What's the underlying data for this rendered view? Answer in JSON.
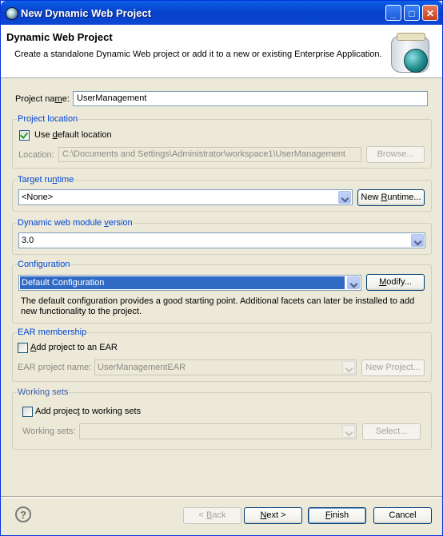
{
  "window": {
    "title": "New Dynamic Web Project",
    "minimize": "_",
    "maximize": "□",
    "close": "✕"
  },
  "header": {
    "title": "Dynamic Web Project",
    "description": "Create a standalone Dynamic Web project or add it to a new or existing Enterprise Application."
  },
  "project_name": {
    "label_pre": "Project na",
    "label_u": "m",
    "label_post": "e:",
    "value": "UserManagement"
  },
  "project_location": {
    "title": "Project location",
    "use_default": {
      "pre": "Use ",
      "u": "d",
      "post": "efault location",
      "checked": true
    },
    "location_label": "Location:",
    "location_value": "C:\\Documents and Settings\\Administrator\\workspace1\\UserManagement",
    "browse_label": "Browse..."
  },
  "target_runtime": {
    "title_pre": "Target ru",
    "title_u": "n",
    "title_post": "time",
    "value": "<None>",
    "new_runtime_pre": "New ",
    "new_runtime_u": "R",
    "new_runtime_post": "untime..."
  },
  "module_version": {
    "title_pre": "Dynamic web module ",
    "title_u": "v",
    "title_post": "ersion",
    "value": "3.0"
  },
  "configuration": {
    "title": "Configuration",
    "value": "Default Configuration",
    "modify_pre": "",
    "modify_u": "M",
    "modify_post": "odify...",
    "description_line1": "The default configuration provides a good starting point. Additional facets can later be installed to add",
    "description_line2": "new functionality to the project."
  },
  "ear": {
    "title": "EAR membership",
    "add_pre": "",
    "add_u": "A",
    "add_post": "dd project to an EAR",
    "checked": false,
    "name_label": "EAR project name:",
    "name_value": "UserManagementEAR",
    "new_project_label": "New Project..."
  },
  "working_sets": {
    "title": "Working sets",
    "add_pre": "Add projec",
    "add_u": "t",
    "add_post": " to working sets",
    "checked": false,
    "label": "Working sets:",
    "value": "",
    "select_label": "Select..."
  },
  "footer": {
    "help": "?",
    "back_pre": "< ",
    "back_u": "B",
    "back_post": "ack",
    "next_pre": "",
    "next_u": "N",
    "next_post": "ext >",
    "finish_pre": "",
    "finish_u": "F",
    "finish_post": "inish",
    "cancel": "Cancel"
  }
}
